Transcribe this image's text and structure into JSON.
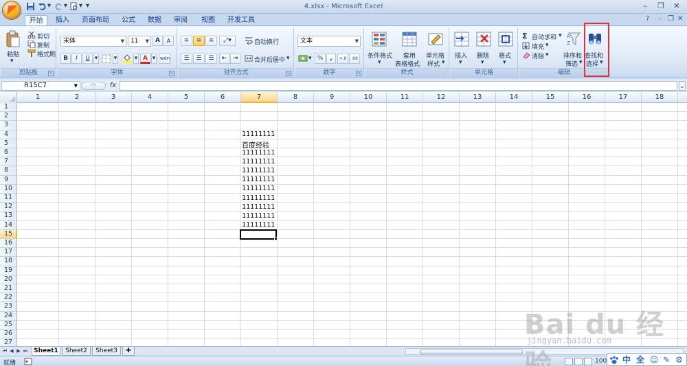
{
  "window": {
    "title": "4.xlsx - Microsoft Excel",
    "controls": {
      "minimize": "–",
      "restore": "❐",
      "close": "✕"
    },
    "help": "?"
  },
  "qat": {
    "customize": "▾"
  },
  "tabs": [
    "开始",
    "插入",
    "页面布局",
    "公式",
    "数据",
    "审阅",
    "视图",
    "开发工具"
  ],
  "ribbon": {
    "clipboard": {
      "label": "剪贴板",
      "paste": "粘贴",
      "cut": "剪切",
      "copy": "复制",
      "format_painter": "格式刷"
    },
    "font": {
      "label": "字体",
      "font_name": "宋体",
      "font_size": "11",
      "bold": "B",
      "italic": "I",
      "underline": "U",
      "grow": "A",
      "shrink": "A",
      "font_color": "A",
      "phonetic": "wén"
    },
    "alignment": {
      "label": "对齐方式",
      "wrap_text": "自动换行",
      "merge_center": "合并后居中"
    },
    "number": {
      "label": "数字",
      "format": "文本",
      "percent": "%",
      "comma": ",",
      "inc_decimal": "+.0",
      "dec_decimal": ".00"
    },
    "styles": {
      "label": "样式",
      "conditional": "条件格式",
      "table_line1": "套用",
      "table_line2": "表格格式",
      "cell_line1": "单元格",
      "cell_line2": "样式"
    },
    "cells": {
      "label": "单元格",
      "insert": "插入",
      "delete": "删除",
      "format": "格式"
    },
    "editing": {
      "label": "编辑",
      "autosum": "自动求和",
      "fill": "填充",
      "clear": "清除",
      "sort_line1": "排序和",
      "sort_line2": "筛选",
      "find_line1": "查找和",
      "find_line2": "选择"
    }
  },
  "formula_bar": {
    "name_box": "R15C7",
    "fx": "fx",
    "value": ""
  },
  "grid": {
    "columns": [
      "1",
      "2",
      "3",
      "4",
      "5",
      "6",
      "7",
      "8",
      "9",
      "10",
      "11",
      "12",
      "13",
      "14",
      "15",
      "16",
      "17",
      "18"
    ],
    "rows": [
      "1",
      "2",
      "3",
      "4",
      "5",
      "6",
      "7",
      "8",
      "9",
      "10",
      "11",
      "12",
      "13",
      "14",
      "15",
      "16",
      "17",
      "18",
      "19",
      "20",
      "21",
      "22",
      "23",
      "24",
      "25",
      "26",
      "27"
    ],
    "selected_column": "7",
    "selected_row": "15",
    "cells": [
      {
        "row": "4",
        "value": "11111111"
      },
      {
        "row": "5",
        "value": "百度经验"
      },
      {
        "row": "6",
        "value": "11111111"
      },
      {
        "row": "7",
        "value": "11111111"
      },
      {
        "row": "8",
        "value": "11111111"
      },
      {
        "row": "9",
        "value": "11111111"
      },
      {
        "row": "10",
        "value": "11111111"
      },
      {
        "row": "11",
        "value": "11111111"
      },
      {
        "row": "12",
        "value": "11111111"
      },
      {
        "row": "13",
        "value": "11111111"
      },
      {
        "row": "14",
        "value": "11111111"
      }
    ]
  },
  "sheets": [
    "Sheet1",
    "Sheet2",
    "Sheet3"
  ],
  "status": {
    "text": "就绪",
    "zoom": "100"
  },
  "ime": [
    "中",
    "全",
    "☺",
    "✎",
    "⚙"
  ],
  "watermark": {
    "brand": "Bai du 经验",
    "url": "jingyan.baidu.com"
  },
  "colors": {
    "highlight_box": "#e0303a",
    "ribbon_text": "#1e395b",
    "selected_header": "#ffd58c"
  }
}
